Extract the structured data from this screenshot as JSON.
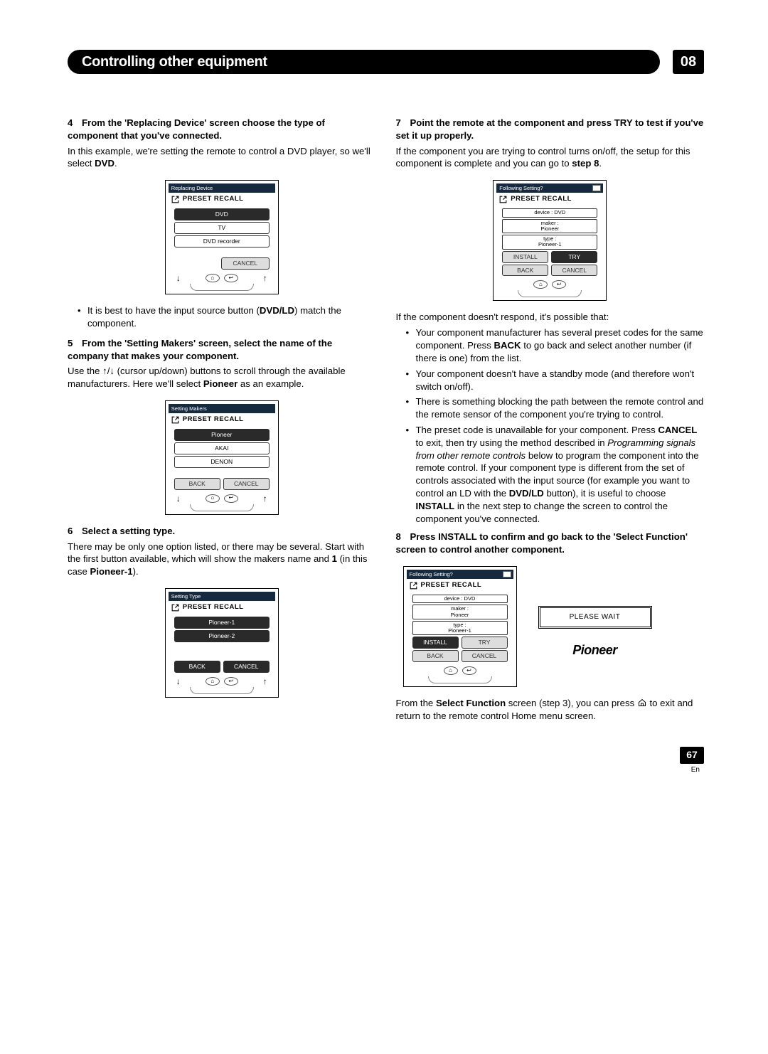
{
  "header": {
    "title": "Controlling other equipment",
    "chapter": "08"
  },
  "left": {
    "s4": {
      "num": "4",
      "head": "From the 'Replacing Device' screen choose the type of component that you've connected.",
      "p1": "In this example, we're setting the remote to control a DVD player, so we'll select ",
      "p1_bold": "DVD",
      "p1_end": "."
    },
    "lcd1": {
      "title": "Replacing Device",
      "preset": "PRESET RECALL",
      "item1": "DVD",
      "item2": "TV",
      "item3": "DVD recorder",
      "cancel": "CANCEL"
    },
    "s4_note": {
      "pre": "It is best to have the input source button (",
      "bold": "DVD/LD",
      "post": ") match the component."
    },
    "s5": {
      "num": "5",
      "head": "From the 'Setting Makers' screen, select the name of the company that makes your component.",
      "p_pre": "Use the ",
      "p_mid": " (cursor up/down) buttons to scroll through the available manufacturers. Here we'll select ",
      "p_bold": "Pioneer",
      "p_end": " as an example."
    },
    "lcd2": {
      "title": "Setting Makers",
      "preset": "PRESET RECALL",
      "item1": "Pioneer",
      "item2": "AKAI",
      "item3": "DENON",
      "back": "BACK",
      "cancel": "CANCEL"
    },
    "s6": {
      "num": "6",
      "head": "Select a setting type.",
      "p_pre": "There may be only one option listed, or there may be several. Start with the first button available, which will show the makers name and ",
      "p_b1": "1",
      "p_mid": " (in this case ",
      "p_b2": "Pioneer-1",
      "p_end": ")."
    },
    "lcd3": {
      "title": "Setting Type",
      "preset": "PRESET RECALL",
      "item1": "Pioneer-1",
      "item2": "Pioneer-2",
      "back": "BACK",
      "cancel": "CANCEL"
    }
  },
  "right": {
    "s7": {
      "num": "7",
      "head": "Point the remote at the component and press TRY to test if you've set it up properly.",
      "p_pre": "If the component you are trying to control turns on/off, the setup for this component is complete and you can go to ",
      "p_bold": "step 8",
      "p_end": "."
    },
    "lcd4": {
      "title": "Following Setting?",
      "preset": "PRESET RECALL",
      "info_device": "device : DVD",
      "info_maker_l1": "maker :",
      "info_maker_l2": "Pioneer",
      "info_type_l1": "type :",
      "info_type_l2": "Pioneer-1",
      "install": "INSTALL",
      "try": "TRY",
      "back": "BACK",
      "cancel": "CANCEL"
    },
    "after7": "If the component doesn't respond, it's possible that:",
    "b1": {
      "pre": "Your component manufacturer has several preset codes for the same component. Press ",
      "bold": "BACK",
      "post": " to go back and select another number (if there is one) from the list."
    },
    "b2": "Your component doesn't have a standby mode (and therefore won't switch on/off).",
    "b3": "There is something blocking the path between the remote control and the remote sensor of the component you're trying to control.",
    "b4": {
      "pre": "The preset code is unavailable for your component. Press ",
      "b1": "CANCEL",
      "mid1": " to exit, then try using the method described in ",
      "ital": "Programming signals from other remote controls",
      "mid2": " below to program the component into the remote control. If your component type is different from the set of controls associated with the input source (for example you want to control an LD with the ",
      "b2": "DVD/LD",
      "mid3": " button), it is useful to choose ",
      "b3": "INSTALL",
      "post": " in the next step to change the screen to control the component you've connected."
    },
    "s8": {
      "num": "8",
      "head": "Press INSTALL to confirm and go back to the 'Select Function' screen to control another component."
    },
    "lcd5": {
      "title": "Following Setting?",
      "preset": "PRESET RECALL",
      "info_device": "device : DVD",
      "info_maker_l1": "maker :",
      "info_maker_l2": "Pioneer",
      "info_type_l1": "type :",
      "info_type_l2": "Pioneer-1",
      "install": "INSTALL",
      "try": "TRY",
      "back": "BACK",
      "cancel": "CANCEL"
    },
    "pleasewait": "PLEASE WAIT",
    "pioneer_logo": "Pioneer",
    "final": {
      "pre": "From the ",
      "b1": "Select Function",
      "mid": " screen (step 3), you can press ",
      "post": " to exit and return to the remote control Home menu screen."
    }
  },
  "footer": {
    "page": "67",
    "lang": "En"
  }
}
